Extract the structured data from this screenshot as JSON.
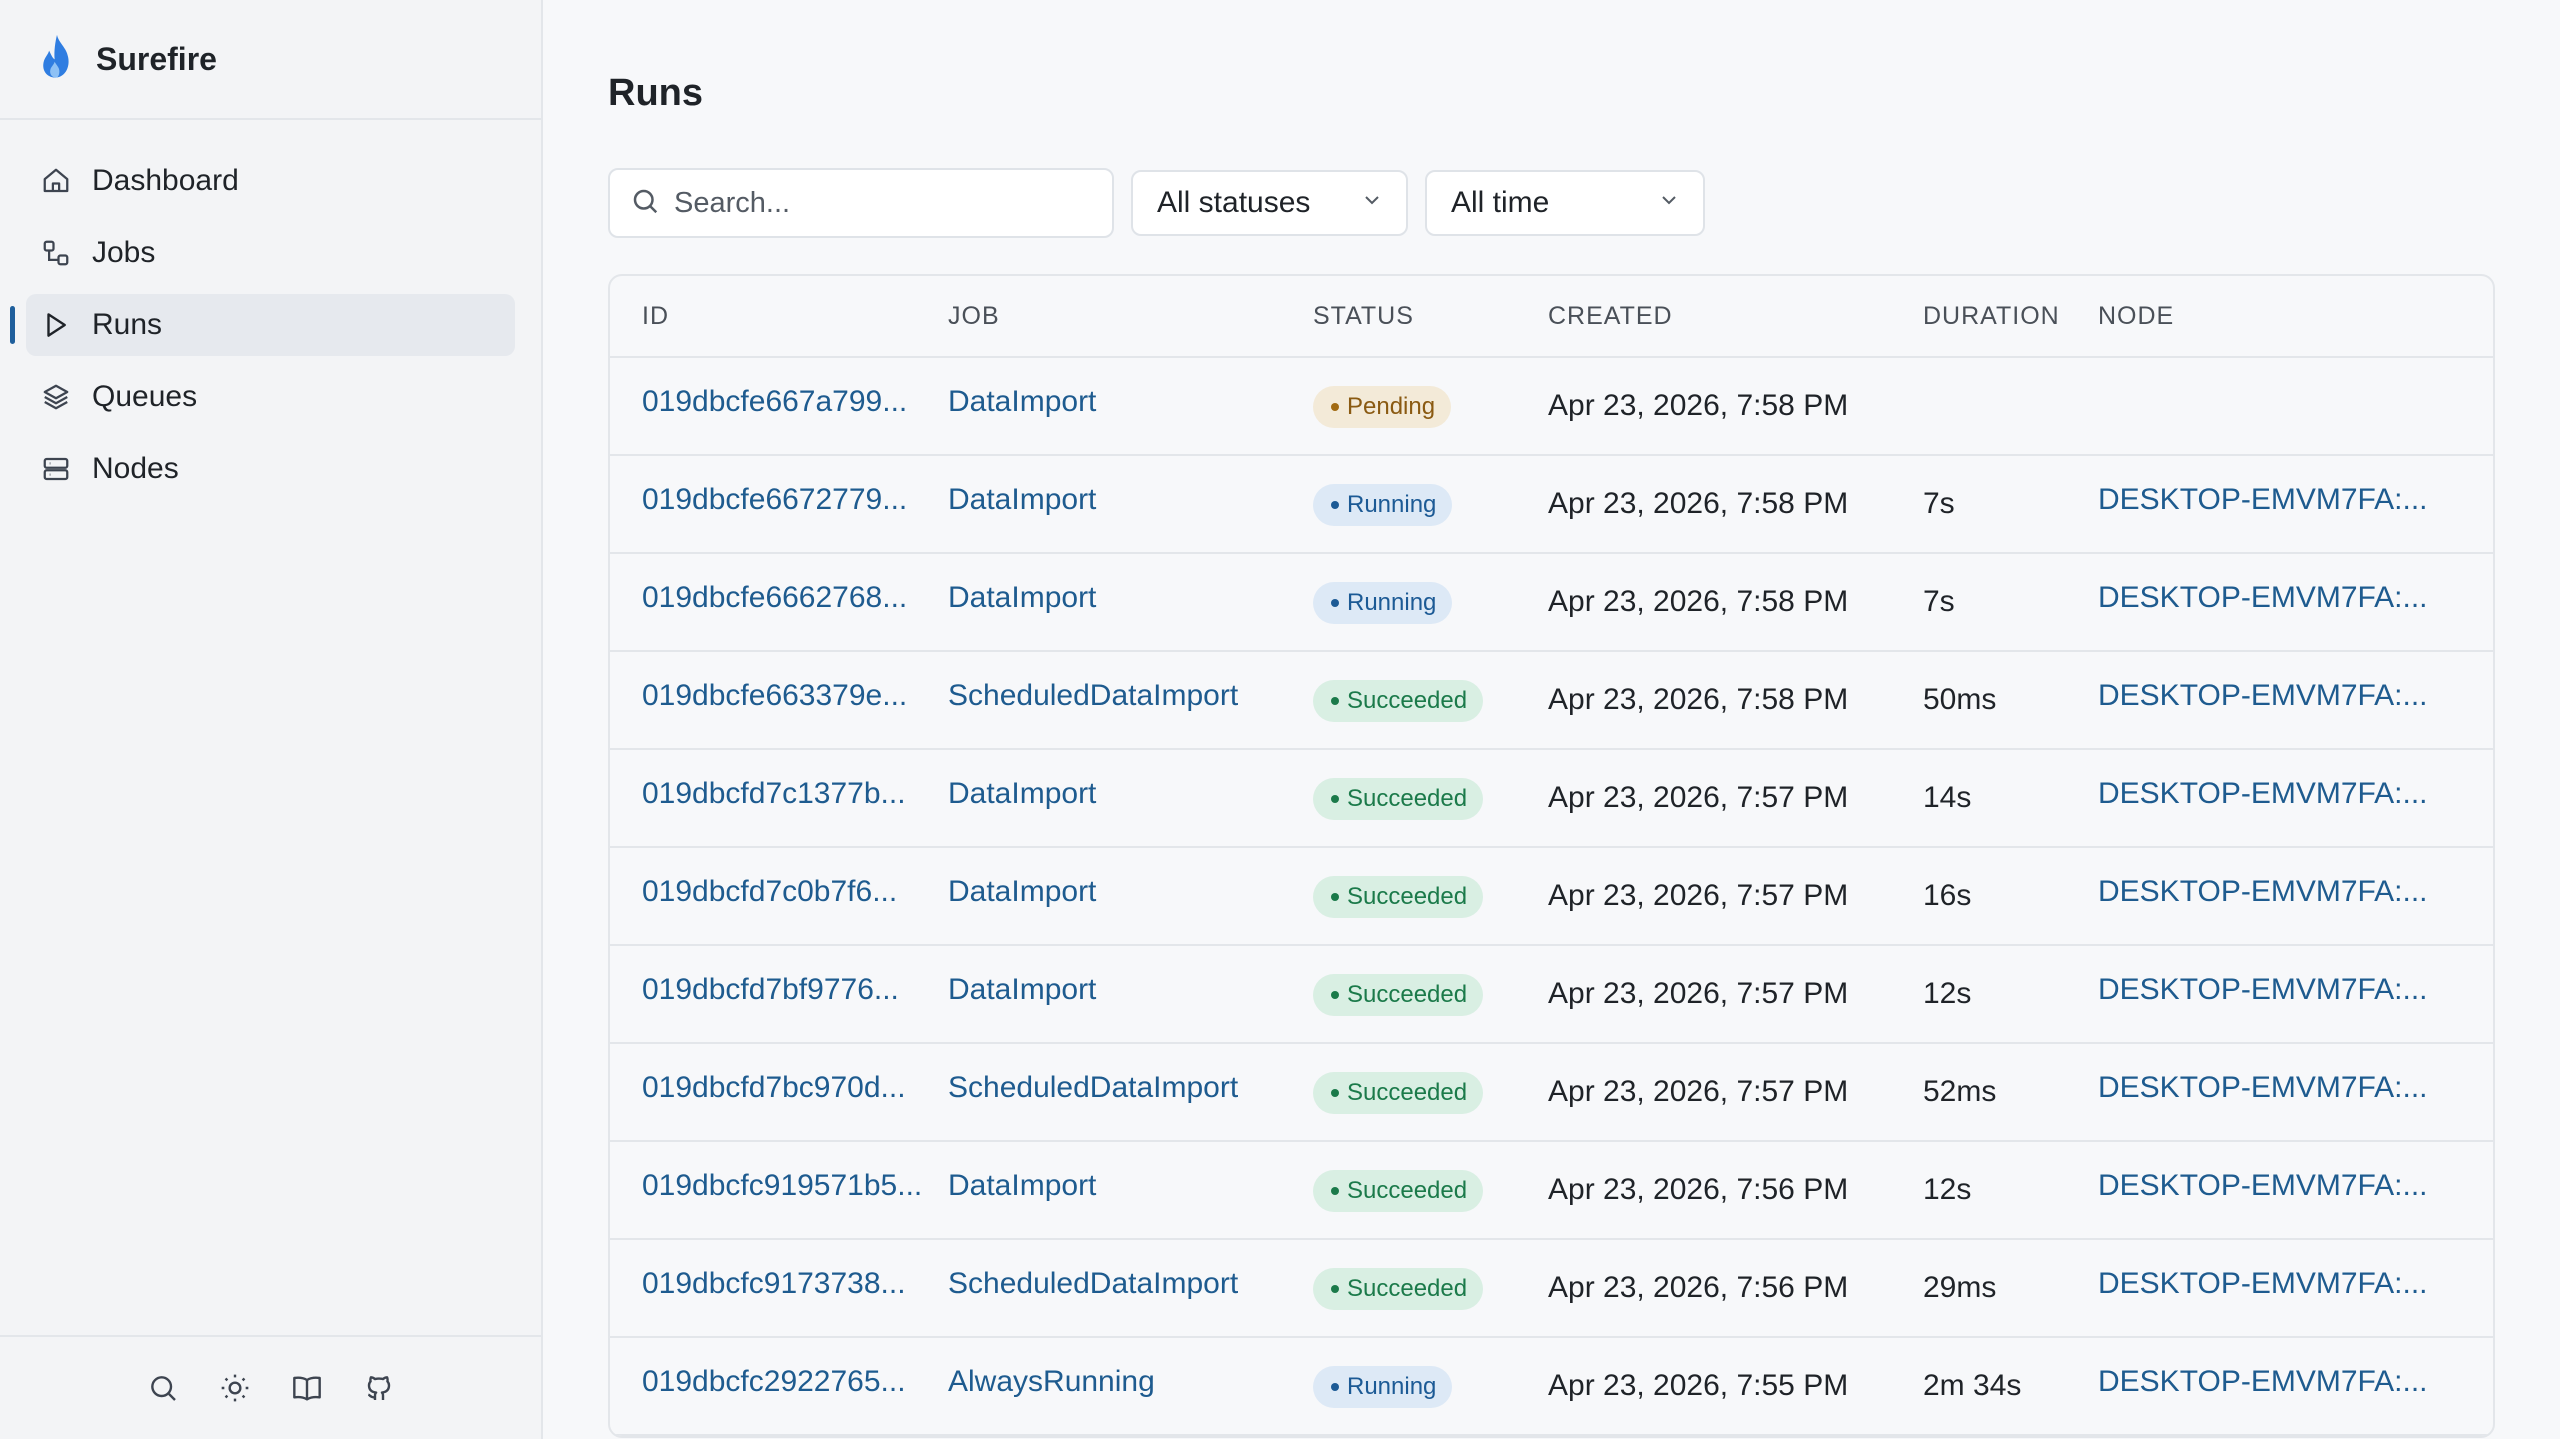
{
  "app": {
    "name": "Surefire"
  },
  "sidebar": {
    "items": [
      {
        "label": "Dashboard",
        "icon": "home-icon"
      },
      {
        "label": "Jobs",
        "icon": "jobs-icon"
      },
      {
        "label": "Runs",
        "icon": "play-icon",
        "active": true
      },
      {
        "label": "Queues",
        "icon": "layers-icon"
      },
      {
        "label": "Nodes",
        "icon": "server-icon"
      }
    ],
    "footer_icons": [
      "search-icon",
      "sun-icon",
      "book-icon",
      "github-icon"
    ]
  },
  "page": {
    "title": "Runs"
  },
  "filters": {
    "search_placeholder": "Search...",
    "status_value": "All statuses",
    "time_value": "All time"
  },
  "table": {
    "headers": {
      "id": "ID",
      "job": "JOB",
      "status": "STATUS",
      "created": "CREATED",
      "duration": "DURATION",
      "node": "NODE"
    },
    "rows": [
      {
        "id": "019dbcfe667a799...",
        "job": "DataImport",
        "status": "Pending",
        "created": "Apr 23, 2026, 7:58 PM",
        "duration": "",
        "node": ""
      },
      {
        "id": "019dbcfe6672779...",
        "job": "DataImport",
        "status": "Running",
        "created": "Apr 23, 2026, 7:58 PM",
        "duration": "7s",
        "node": "DESKTOP-EMVM7FA:..."
      },
      {
        "id": "019dbcfe6662768...",
        "job": "DataImport",
        "status": "Running",
        "created": "Apr 23, 2026, 7:58 PM",
        "duration": "7s",
        "node": "DESKTOP-EMVM7FA:..."
      },
      {
        "id": "019dbcfe663379e...",
        "job": "ScheduledDataImport",
        "status": "Succeeded",
        "created": "Apr 23, 2026, 7:58 PM",
        "duration": "50ms",
        "node": "DESKTOP-EMVM7FA:..."
      },
      {
        "id": "019dbcfd7c1377b...",
        "job": "DataImport",
        "status": "Succeeded",
        "created": "Apr 23, 2026, 7:57 PM",
        "duration": "14s",
        "node": "DESKTOP-EMVM7FA:..."
      },
      {
        "id": "019dbcfd7c0b7f6...",
        "job": "DataImport",
        "status": "Succeeded",
        "created": "Apr 23, 2026, 7:57 PM",
        "duration": "16s",
        "node": "DESKTOP-EMVM7FA:..."
      },
      {
        "id": "019dbcfd7bf9776...",
        "job": "DataImport",
        "status": "Succeeded",
        "created": "Apr 23, 2026, 7:57 PM",
        "duration": "12s",
        "node": "DESKTOP-EMVM7FA:..."
      },
      {
        "id": "019dbcfd7bc970d...",
        "job": "ScheduledDataImport",
        "status": "Succeeded",
        "created": "Apr 23, 2026, 7:57 PM",
        "duration": "52ms",
        "node": "DESKTOP-EMVM7FA:..."
      },
      {
        "id": "019dbcfc919571b5...",
        "job": "DataImport",
        "status": "Succeeded",
        "created": "Apr 23, 2026, 7:56 PM",
        "duration": "12s",
        "node": "DESKTOP-EMVM7FA:..."
      },
      {
        "id": "019dbcfc9173738...",
        "job": "ScheduledDataImport",
        "status": "Succeeded",
        "created": "Apr 23, 2026, 7:56 PM",
        "duration": "29ms",
        "node": "DESKTOP-EMVM7FA:..."
      },
      {
        "id": "019dbcfc2922765...",
        "job": "AlwaysRunning",
        "status": "Running",
        "created": "Apr 23, 2026, 7:55 PM",
        "duration": "2m 34s",
        "node": "DESKTOP-EMVM7FA:..."
      }
    ]
  },
  "colors": {
    "link": "#1e5b8f",
    "brand": "#2f7de1",
    "accent": "#1f5f9c"
  }
}
